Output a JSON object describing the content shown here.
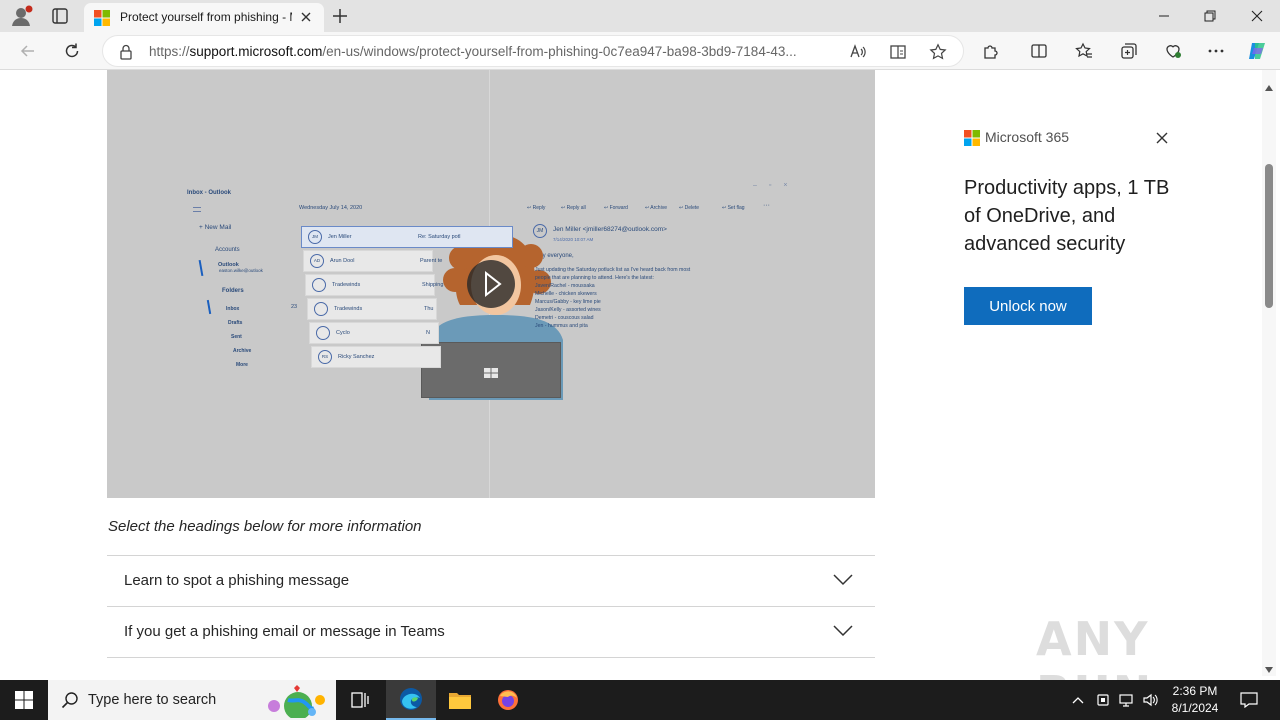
{
  "browser": {
    "tab_title": "Protect yourself from phishing - Microsoft Support",
    "url_prefix": "https://",
    "url_domain": "support.microsoft.com",
    "url_path": "/en-us/windows/protect-yourself-from-phishing-0c7ea947-ba98-3bd9-7184-43...",
    "accent": "#0f6cbd"
  },
  "video": {
    "mail_title": "Inbox - Outlook",
    "date": "Wednesday July 14, 2020",
    "new_mail": "New Mail",
    "accounts": "Accounts",
    "account_name": "Outlook",
    "account_email": "easton.wilke@outlook",
    "folders": "Folders",
    "folder_items": [
      "Inbox",
      "Drafts",
      "Sent",
      "Archive",
      "More"
    ],
    "inbox_count": "23",
    "actions": [
      "Reply",
      "Reply all",
      "Forward",
      "Archive",
      "Delete",
      "Set flag"
    ],
    "messages": [
      {
        "initials": "JM",
        "sender": "Jen Miller",
        "subject": "Re: Saturday potl"
      },
      {
        "initials": "AD",
        "sender": "Arun Dool",
        "subject": "Parent te"
      },
      {
        "initials": "",
        "sender": "Tradewinds",
        "subject": "Shipping"
      },
      {
        "initials": "",
        "sender": "Tradewinds",
        "subject": "Thu"
      },
      {
        "initials": "",
        "sender": "Cyclo",
        "subject": "N"
      },
      {
        "initials": "RS",
        "sender": "Ricky Sanchez",
        "subject": ""
      }
    ],
    "reading_initials": "JM",
    "reading_from": "Jen Miller <jmiller68274@outlook.com>",
    "reading_date": "7/14/2020 10:07 AM",
    "greeting": "Hey everyone,",
    "body_lines": [
      "Just updating the Saturday potluck list as I've heard back from most",
      "people that are planning to attend. Here's the latest:",
      "Javen/Rachel - moussaka",
      "Michelle - chicken skewers",
      "Marcus/Gabby - key lime pie",
      "Jason/Kelly - assorted wines",
      "Demetri - couscous salad",
      "Jen - hummus and pita"
    ]
  },
  "content": {
    "caption": "Select the headings below for more information",
    "accordions": [
      "Learn to spot a phishing message",
      "If you get a phishing email or message in Teams"
    ]
  },
  "ad": {
    "brand": "Microsoft 365",
    "headline": "Productivity apps, 1 TB of OneDrive, and advanced security",
    "button": "Unlock now"
  },
  "taskbar": {
    "search_placeholder": "Type here to search",
    "time": "2:36 PM",
    "date": "8/1/2024"
  },
  "watermark": "ANY RUN"
}
